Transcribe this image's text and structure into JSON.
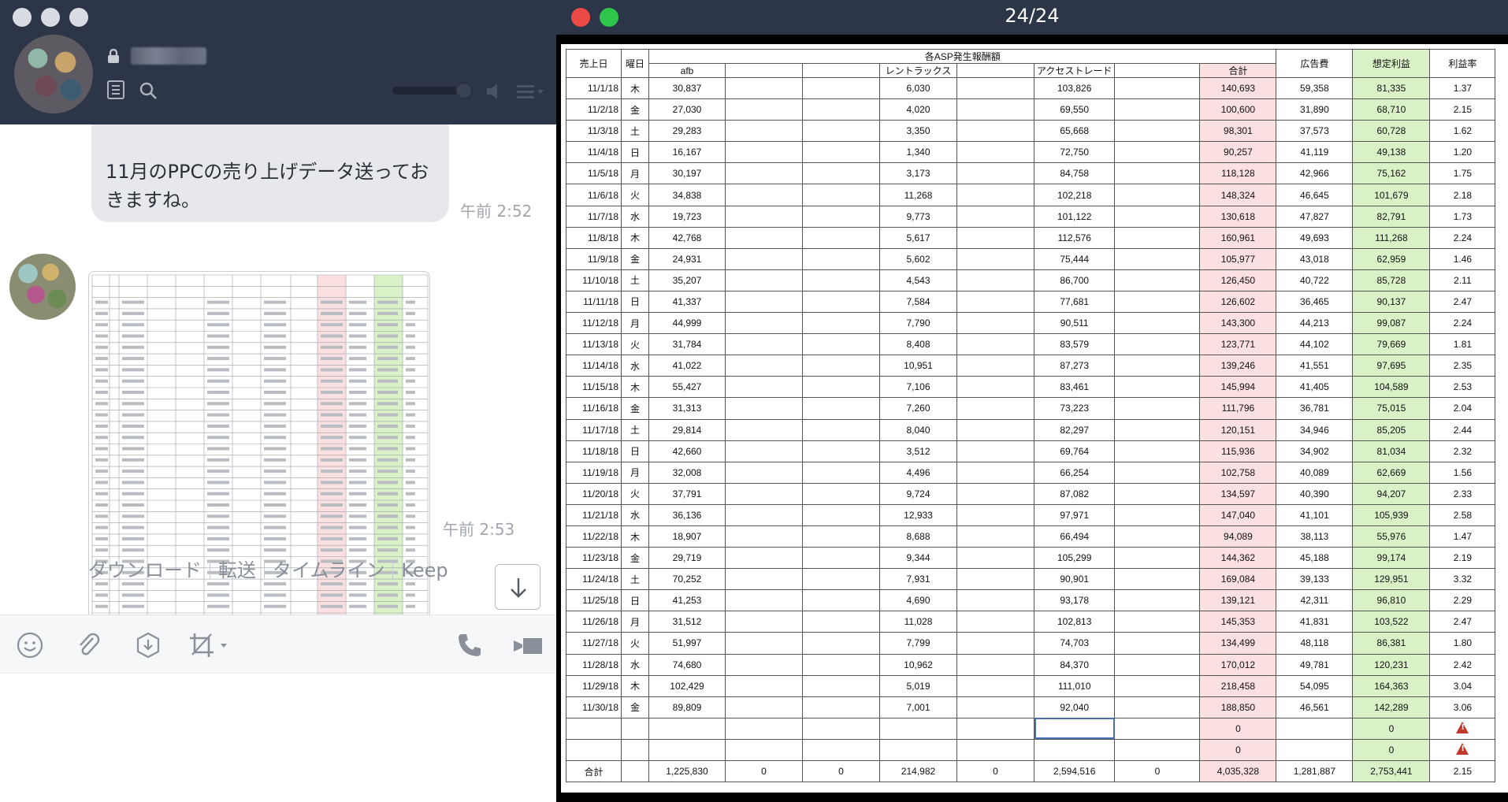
{
  "chat": {
    "message_text": "11月のPPCの売り上げデータ送っておきますね。",
    "message_time": "午前 2:52",
    "image_time": "午前 2:53",
    "actions": [
      "ダウンロード",
      "転送",
      "タイムライン",
      "Keep"
    ]
  },
  "viewer": {
    "title": "24/24"
  },
  "sheet": {
    "headers": {
      "date": "売上日",
      "weekday": "曜日",
      "asp_group": "各ASP発生報酬額",
      "afb": "afb",
      "rentracks": "レントラックス",
      "accesstrade": "アクセストレード",
      "total": "合計",
      "ad_cost": "広告費",
      "profit": "想定利益",
      "margin": "利益率"
    },
    "rows": [
      [
        "11/1/18",
        "木",
        "30,837",
        "6,030",
        "103,826",
        "140,693",
        "59,358",
        "81,335",
        "1.37"
      ],
      [
        "11/2/18",
        "金",
        "27,030",
        "4,020",
        "69,550",
        "100,600",
        "31,890",
        "68,710",
        "2.15"
      ],
      [
        "11/3/18",
        "土",
        "29,283",
        "3,350",
        "65,668",
        "98,301",
        "37,573",
        "60,728",
        "1.62"
      ],
      [
        "11/4/18",
        "日",
        "16,167",
        "1,340",
        "72,750",
        "90,257",
        "41,119",
        "49,138",
        "1.20"
      ],
      [
        "11/5/18",
        "月",
        "30,197",
        "3,173",
        "84,758",
        "118,128",
        "42,966",
        "75,162",
        "1.75"
      ],
      [
        "11/6/18",
        "火",
        "34,838",
        "11,268",
        "102,218",
        "148,324",
        "46,645",
        "101,679",
        "2.18"
      ],
      [
        "11/7/18",
        "水",
        "19,723",
        "9,773",
        "101,122",
        "130,618",
        "47,827",
        "82,791",
        "1.73"
      ],
      [
        "11/8/18",
        "木",
        "42,768",
        "5,617",
        "112,576",
        "160,961",
        "49,693",
        "111,268",
        "2.24"
      ],
      [
        "11/9/18",
        "金",
        "24,931",
        "5,602",
        "75,444",
        "105,977",
        "43,018",
        "62,959",
        "1.46"
      ],
      [
        "11/10/18",
        "土",
        "35,207",
        "4,543",
        "86,700",
        "126,450",
        "40,722",
        "85,728",
        "2.11"
      ],
      [
        "11/11/18",
        "日",
        "41,337",
        "7,584",
        "77,681",
        "126,602",
        "36,465",
        "90,137",
        "2.47"
      ],
      [
        "11/12/18",
        "月",
        "44,999",
        "7,790",
        "90,511",
        "143,300",
        "44,213",
        "99,087",
        "2.24"
      ],
      [
        "11/13/18",
        "火",
        "31,784",
        "8,408",
        "83,579",
        "123,771",
        "44,102",
        "79,669",
        "1.81"
      ],
      [
        "11/14/18",
        "水",
        "41,022",
        "10,951",
        "87,273",
        "139,246",
        "41,551",
        "97,695",
        "2.35"
      ],
      [
        "11/15/18",
        "木",
        "55,427",
        "7,106",
        "83,461",
        "145,994",
        "41,405",
        "104,589",
        "2.53"
      ],
      [
        "11/16/18",
        "金",
        "31,313",
        "7,260",
        "73,223",
        "111,796",
        "36,781",
        "75,015",
        "2.04"
      ],
      [
        "11/17/18",
        "土",
        "29,814",
        "8,040",
        "82,297",
        "120,151",
        "34,946",
        "85,205",
        "2.44"
      ],
      [
        "11/18/18",
        "日",
        "42,660",
        "3,512",
        "69,764",
        "115,936",
        "34,902",
        "81,034",
        "2.32"
      ],
      [
        "11/19/18",
        "月",
        "32,008",
        "4,496",
        "66,254",
        "102,758",
        "40,089",
        "62,669",
        "1.56"
      ],
      [
        "11/20/18",
        "火",
        "37,791",
        "9,724",
        "87,082",
        "134,597",
        "40,390",
        "94,207",
        "2.33"
      ],
      [
        "11/21/18",
        "水",
        "36,136",
        "12,933",
        "97,971",
        "147,040",
        "41,101",
        "105,939",
        "2.58"
      ],
      [
        "11/22/18",
        "木",
        "18,907",
        "8,688",
        "66,494",
        "94,089",
        "38,113",
        "55,976",
        "1.47"
      ],
      [
        "11/23/18",
        "金",
        "29,719",
        "9,344",
        "105,299",
        "144,362",
        "45,188",
        "99,174",
        "2.19"
      ],
      [
        "11/24/18",
        "土",
        "70,252",
        "7,931",
        "90,901",
        "169,084",
        "39,133",
        "129,951",
        "3.32"
      ],
      [
        "11/25/18",
        "日",
        "41,253",
        "4,690",
        "93,178",
        "139,121",
        "42,311",
        "96,810",
        "2.29"
      ],
      [
        "11/26/18",
        "月",
        "31,512",
        "11,028",
        "102,813",
        "145,353",
        "41,831",
        "103,522",
        "2.47"
      ],
      [
        "11/27/18",
        "火",
        "51,997",
        "7,799",
        "74,703",
        "134,499",
        "48,118",
        "86,381",
        "1.80"
      ],
      [
        "11/28/18",
        "水",
        "74,680",
        "10,962",
        "84,370",
        "170,012",
        "49,781",
        "120,231",
        "2.42"
      ],
      [
        "11/29/18",
        "木",
        "102,429",
        "5,019",
        "111,010",
        "218,458",
        "54,095",
        "164,363",
        "3.04"
      ],
      [
        "11/30/18",
        "金",
        "89,809",
        "7,001",
        "92,040",
        "188,850",
        "46,561",
        "142,289",
        "3.06"
      ]
    ],
    "empty_rows": [
      {
        "total": "0",
        "profit": "0"
      },
      {
        "total": "0",
        "profit": "0"
      }
    ],
    "totals": {
      "label": "合計",
      "afb": "1,225,830",
      "blank1": "0",
      "blank2": "0",
      "rentracks": "214,982",
      "blank3": "0",
      "accesstrade": "2,594,516",
      "blank4": "0",
      "total": "4,035,328",
      "ad_cost": "1,281,887",
      "profit": "2,753,441",
      "margin": "2.15"
    }
  }
}
